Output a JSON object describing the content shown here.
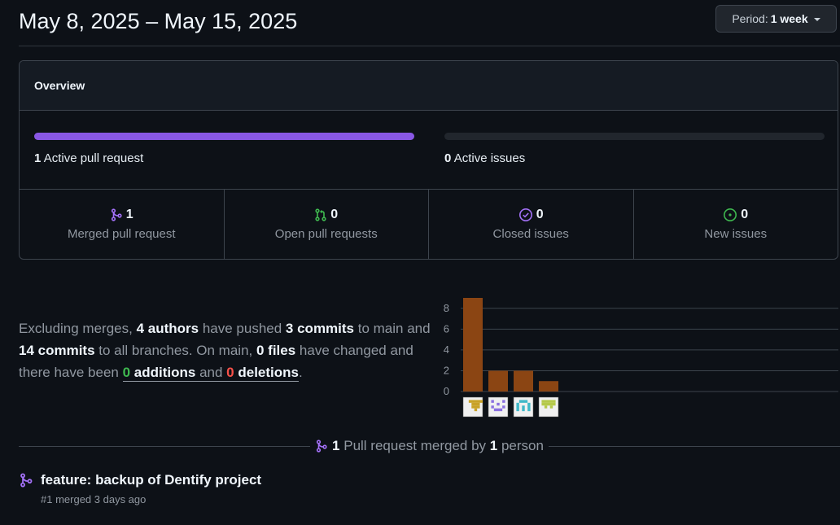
{
  "header": {
    "date_range": "May 8, 2025 – May 15, 2025",
    "period_label": "Period:",
    "period_value": "1 week"
  },
  "overview": {
    "title": "Overview",
    "pull_requests": {
      "count": "1",
      "label": "Active pull request",
      "fill_fraction": 1.0
    },
    "issues": {
      "count": "0",
      "label": "Active issues",
      "fill_fraction": 0.0
    },
    "stats": [
      {
        "icon": "git-merge-icon",
        "count": "1",
        "label": "Merged pull request",
        "color": "#a371f7"
      },
      {
        "icon": "git-pull-request-icon",
        "count": "0",
        "label": "Open pull requests",
        "color": "#3fb950"
      },
      {
        "icon": "issue-closed-icon",
        "count": "0",
        "label": "Closed issues",
        "color": "#a371f7"
      },
      {
        "icon": "issue-opened-icon",
        "count": "0",
        "label": "New issues",
        "color": "#3fb950"
      }
    ]
  },
  "summary": {
    "t1": "Excluding merges, ",
    "authors": "4 authors",
    "t2": " have pushed ",
    "commits_main": "3 commits",
    "t3": " to main and ",
    "commits_all": "14 commits",
    "t4": " to all branches. On main, ",
    "files": "0 files",
    "t5": " have changed and there have been ",
    "additions_num": "0",
    "additions_word": " additions",
    "t6": " and ",
    "deletions_num": "0",
    "deletions_word": " deletions",
    "t7": "."
  },
  "chart_data": {
    "type": "bar",
    "categories": [
      "author-1",
      "author-2",
      "author-3",
      "author-4"
    ],
    "values": [
      9,
      2,
      2,
      1
    ],
    "yticks": [
      "0",
      "2",
      "4",
      "6",
      "8"
    ],
    "ylim": [
      0,
      9
    ],
    "bar_color": "#8b4513",
    "avatar_colors": [
      "#c9a227",
      "#8a6fe0",
      "#3fb8c8",
      "#b5c94a"
    ]
  },
  "merged_summary": {
    "count": "1",
    "t1": " Pull request merged by ",
    "people": "1",
    "t2": " person"
  },
  "pull_request": {
    "title": "feature: backup of Dentify project",
    "meta": "#1 merged 3 days ago"
  }
}
